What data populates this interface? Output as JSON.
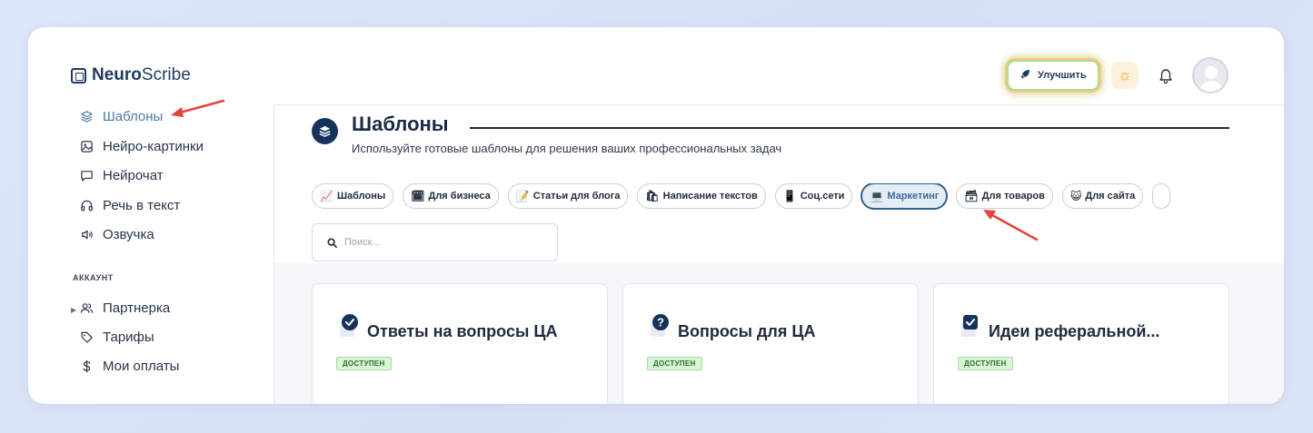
{
  "app": {
    "logo_bold": "Neuro",
    "logo_rest": "Scribe"
  },
  "header": {
    "upgrade_label": "Улучшить"
  },
  "sidebar": {
    "items": [
      {
        "label": "Шаблоны",
        "icon": "stack-icon",
        "active": true
      },
      {
        "label": "Нейро-картинки",
        "icon": "image-icon"
      },
      {
        "label": "Нейрочат",
        "icon": "chat-icon"
      },
      {
        "label": "Речь в текст",
        "icon": "headphones-icon"
      },
      {
        "label": "Озвучка",
        "icon": "speaker-icon"
      }
    ],
    "section_label": "АККАУНТ",
    "account_items": [
      {
        "label": "Партнерка",
        "icon": "users-icon"
      },
      {
        "label": "Тарифы",
        "icon": "tag-icon"
      },
      {
        "label": "Мои оплаты",
        "icon": "dollar-icon"
      }
    ]
  },
  "main": {
    "title": "Шаблоны",
    "subtitle": "Используйте готовые шаблоны для решения ваших профессиональных задач",
    "chips": [
      {
        "emoji": "📈",
        "label": "Шаблоны"
      },
      {
        "emoji": "🗓",
        "label": "Для бизнеса"
      },
      {
        "emoji": "📝",
        "label": "Статьи для блога"
      },
      {
        "emoji": "🛍",
        "label": "Написание текстов"
      },
      {
        "emoji": "📱",
        "label": "Соц.сети"
      },
      {
        "emoji": "💻",
        "label": "Маркетинг",
        "active": true
      },
      {
        "emoji": "🗃",
        "label": "Для товаров"
      },
      {
        "emoji": "😺",
        "label": "Для сайта"
      }
    ],
    "search_placeholder": "Поиск...",
    "cards": [
      {
        "title": "Ответы на вопросы ЦА",
        "badge": "ДОСТУПЕН",
        "icon": "check-badge-icon"
      },
      {
        "title": "Вопросы для ЦА",
        "badge": "ДОСТУПЕН",
        "icon": "question-badge-icon"
      },
      {
        "title": "Идеи реферальной...",
        "badge": "ДОСТУПЕН",
        "icon": "checkbox-icon"
      }
    ]
  },
  "colors": {
    "accent": "#4a7ba8",
    "primary": "#16335a",
    "annotation": "#e8403a",
    "badge_bg": "#daf5d6"
  }
}
